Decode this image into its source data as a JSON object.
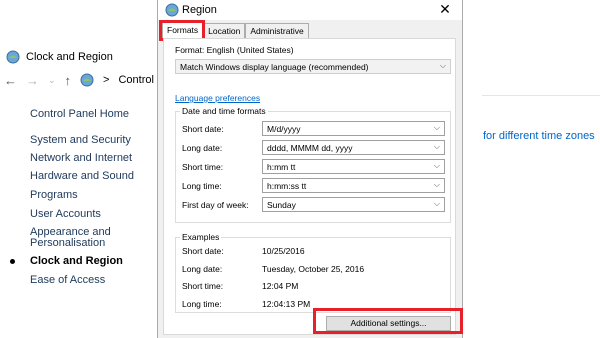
{
  "control_panel": {
    "window_title": "Clock and Region",
    "breadcrumb": {
      "current": "Control",
      "separator": ">"
    },
    "sidebar": [
      {
        "label": "Control Panel Home",
        "active": false
      },
      {
        "label": "System and Security",
        "active": false
      },
      {
        "label": "Network and Internet",
        "active": false
      },
      {
        "label": "Hardware and Sound",
        "active": false
      },
      {
        "label": "Programs",
        "active": false
      },
      {
        "label": "User Accounts",
        "active": false
      },
      {
        "label": "Appearance and",
        "active": false
      },
      {
        "label": "Personalisation",
        "active": false
      },
      {
        "label": "Clock and Region",
        "active": true
      },
      {
        "label": "Ease of Access",
        "active": false
      }
    ],
    "right_link": "for different time zones"
  },
  "dialog": {
    "title": "Region",
    "close_glyph": "✕",
    "tabs": [
      "Formats",
      "Location",
      "Administrative"
    ],
    "selected_tab": "Formats",
    "format_label": "Format: English (United States)",
    "format_value": "Match Windows display language (recommended)",
    "language_link": "Language preferences",
    "date_time_group": "Date and time formats",
    "fields": [
      {
        "label": "Short date:",
        "value": "M/d/yyyy"
      },
      {
        "label": "Long date:",
        "value": "dddd, MMMM dd, yyyy"
      },
      {
        "label": "Short time:",
        "value": "h:mm tt"
      },
      {
        "label": "Long time:",
        "value": "h:mm:ss tt"
      },
      {
        "label": "First day of week:",
        "value": "Sunday"
      }
    ],
    "examples_group": "Examples",
    "examples": [
      {
        "label": "Short date:",
        "value": "10/25/2016"
      },
      {
        "label": "Long date:",
        "value": "Tuesday, October 25, 2016"
      },
      {
        "label": "Short time:",
        "value": "12:04 PM"
      },
      {
        "label": "Long time:",
        "value": "12:04:13 PM"
      }
    ],
    "additional_button": "Additional settings..."
  },
  "colors": {
    "highlight": "#e8202a",
    "link": "#0066cc"
  }
}
